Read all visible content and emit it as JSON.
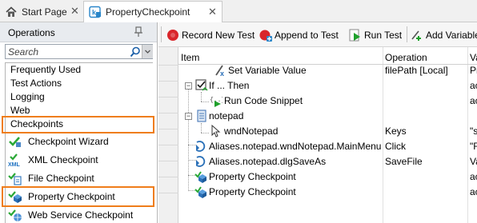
{
  "tabs": [
    {
      "label": "Start Page",
      "icon": "home-icon",
      "active": false
    },
    {
      "label": "PropertyCheckpoint",
      "icon": "keyword-test-icon",
      "active": true
    }
  ],
  "operations_panel": {
    "title": "Operations",
    "search_placeholder": "Search",
    "categories": [
      "Frequently Used",
      "Test Actions",
      "Logging",
      "Web",
      "Checkpoints"
    ],
    "highlighted_category": "Checkpoints",
    "items": [
      {
        "label": "Checkpoint Wizard",
        "icon": "checkpoint-wizard-icon"
      },
      {
        "label": "XML Checkpoint",
        "icon": "xml-checkpoint-icon"
      },
      {
        "label": "File Checkpoint",
        "icon": "file-checkpoint-icon"
      },
      {
        "label": "Property Checkpoint",
        "icon": "property-checkpoint-icon"
      },
      {
        "label": "Web Service Checkpoint",
        "icon": "web-service-checkpoint-icon"
      }
    ],
    "highlighted_item": "Property Checkpoint",
    "highlight_color": "#ef7d1a"
  },
  "toolbar": {
    "record_label": "Record New Test",
    "append_label": "Append to Test",
    "run_label": "Run Test",
    "add_var_label": "Add Variable"
  },
  "grid": {
    "columns": [
      "Item",
      "Operation",
      "Va"
    ],
    "rows": [
      {
        "item": "Set Variable Value",
        "operation": "filePath [Local]",
        "value": "Pr",
        "icon": "set-variable-icon"
      },
      {
        "item": "If ... Then",
        "operation": "",
        "value": "ac",
        "icon": "if-then-icon"
      },
      {
        "item": "Run Code Snippet",
        "operation": "",
        "value": "ac",
        "icon": "run-code-snippet-icon"
      },
      {
        "item": "notepad",
        "operation": "",
        "value": "",
        "icon": "notepad-process-icon"
      },
      {
        "item": "wndNotepad",
        "operation": "Keys",
        "value": "\"s",
        "icon": "window-object-icon"
      },
      {
        "item": "Aliases.notepad.wndNotepad.MainMenu",
        "operation": "Click",
        "value": "\"F",
        "icon": "menu-action-icon"
      },
      {
        "item": "Aliases.notepad.dlgSaveAs",
        "operation": "SaveFile",
        "value": "Va",
        "icon": "dialog-action-icon"
      },
      {
        "item": "Property Checkpoint",
        "operation": "",
        "value": "ac",
        "icon": "property-checkpoint-icon"
      },
      {
        "item": "Property Checkpoint",
        "operation": "",
        "value": "ac",
        "icon": "property-checkpoint-icon"
      }
    ]
  }
}
